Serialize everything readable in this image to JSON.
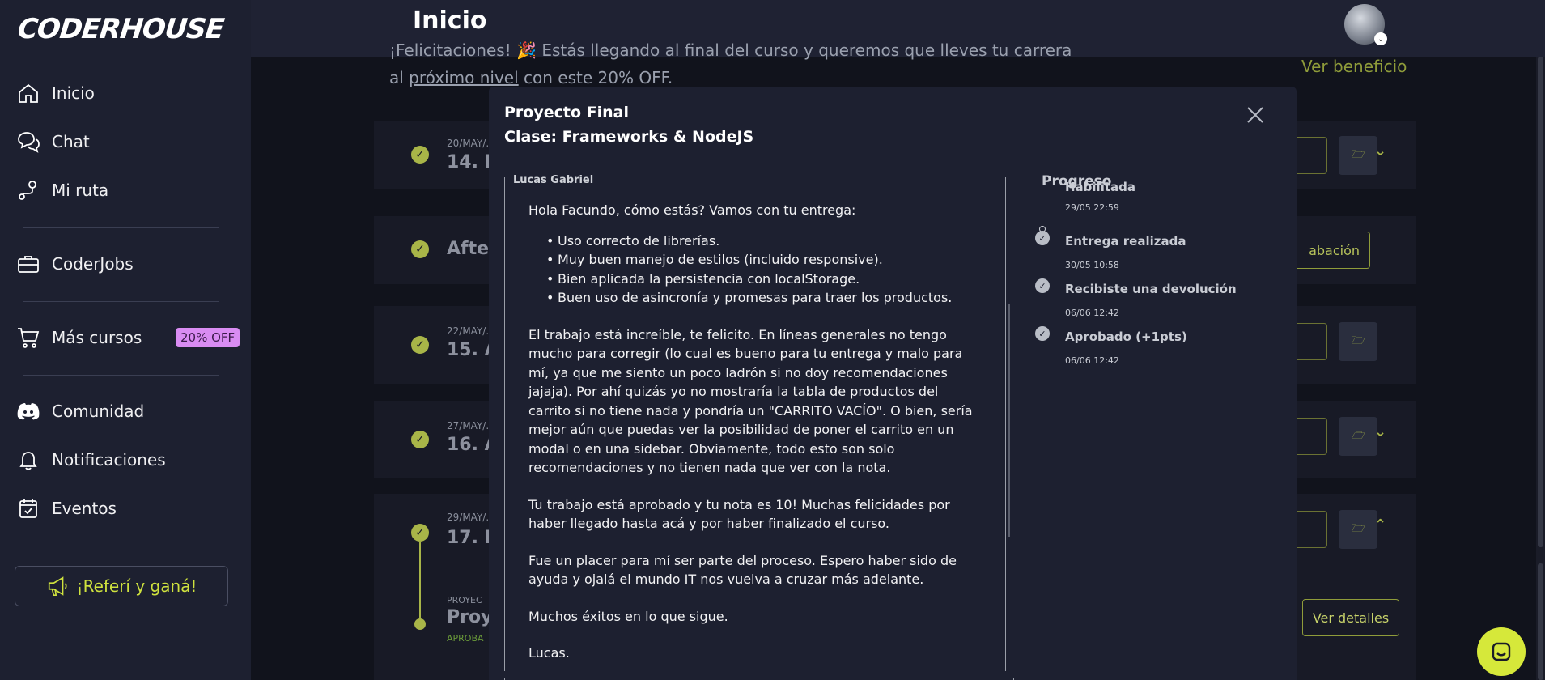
{
  "brand": {
    "logo": "CODERHOUSE"
  },
  "header": {
    "title": "Inicio"
  },
  "sidebar": {
    "items": [
      {
        "label": "Inicio",
        "icon": "home-icon"
      },
      {
        "label": "Chat",
        "icon": "chat-icon"
      },
      {
        "label": "Mi ruta",
        "icon": "route-icon"
      },
      {
        "label": "CoderJobs",
        "icon": "briefcase-icon"
      },
      {
        "label": "Más cursos",
        "icon": "cart-icon",
        "badge": "20% OFF"
      },
      {
        "label": "Comunidad",
        "icon": "discord-icon"
      },
      {
        "label": "Notificaciones",
        "icon": "bell-icon"
      },
      {
        "label": "Eventos",
        "icon": "calendar-icon"
      }
    ],
    "refer_label": "¡Referí y ganá!"
  },
  "background": {
    "promo_line1": "¡Felicitaciones! 🎉 Estás llegando al final del curso y queremos que lleves tu carrera",
    "promo_line2_prefix": "al ",
    "promo_link": "próximo nivel",
    "promo_line2_suffix": " con este 20% OFF.",
    "ver_beneficio": "Ver beneficio",
    "cards": [
      {
        "date": "20/MAY/...",
        "title": "14. L"
      },
      {
        "date": "",
        "title": "Afte"
      },
      {
        "date": "22/MAY/...",
        "title": "15. A"
      },
      {
        "date": "27/MAY/...",
        "title": "16. A"
      },
      {
        "date": "29/MAY/...",
        "title": "17. Fr"
      }
    ],
    "grabacion_label": "abación",
    "project_row": {
      "label": "PROYEC",
      "title": "Proye",
      "status": "APROBA"
    },
    "ver_detalles": "Ver detalles"
  },
  "modal": {
    "title_line1": "Proyecto Final",
    "title_line2": "Clase: Frameworks & NodeJS",
    "author": "Lucas Gabriel",
    "greeting": "Hola Facundo, cómo estás? Vamos con tu entrega:",
    "bullets": [
      "Uso correcto de librerías.",
      "Muy buen manejo de estilos (incluido responsive).",
      "Bien aplicada la persistencia con localStorage.",
      "Buen uso de asincronía y promesas para traer los productos."
    ],
    "paragraph1": "El trabajo está increíble, te felicito. En líneas generales no tengo mucho para corregir (lo cual es bueno para tu entrega y malo para mí, ya que me siento un poco ladrón si no doy recomendaciones jajaja). Por ahí quizás yo no mostraría la tabla de productos del carrito si no tiene nada y pondría un \"CARRITO VACÍO\". O bien, sería mejor aún que puedas ver la posibilidad de poner el carrito en un modal o en una sidebar. Obviamente, todo esto son solo recomendaciones y no tienen nada que ver con la nota.",
    "paragraph2": "Tu trabajo está aprobado y tu nota es 10! Muchas felicidades por haber llegado hasta acá y por haber finalizado el curso.",
    "paragraph3": "Fue un placer para mí ser parte del proceso. Espero haber sido de ayuda y ojalá el mundo IT nos vuelva a cruzar más adelante.",
    "paragraph4": "Muchos éxitos en lo que sigue.",
    "signature": "Lucas.",
    "progress": {
      "title": "Progreso",
      "steps": [
        {
          "label": "Habilitada",
          "date": "29/05 22:59"
        },
        {
          "label": "Entrega realizada",
          "date": "30/05 10:58"
        },
        {
          "label": "Recibiste una devolución",
          "date": "06/06 12:42"
        },
        {
          "label": "Aprobado (+1pts)",
          "date": "06/06 12:42"
        }
      ]
    }
  },
  "colors": {
    "accent": "#cfe23e",
    "sidebar_bg": "#1d2030",
    "badge": "#d98cf2"
  }
}
